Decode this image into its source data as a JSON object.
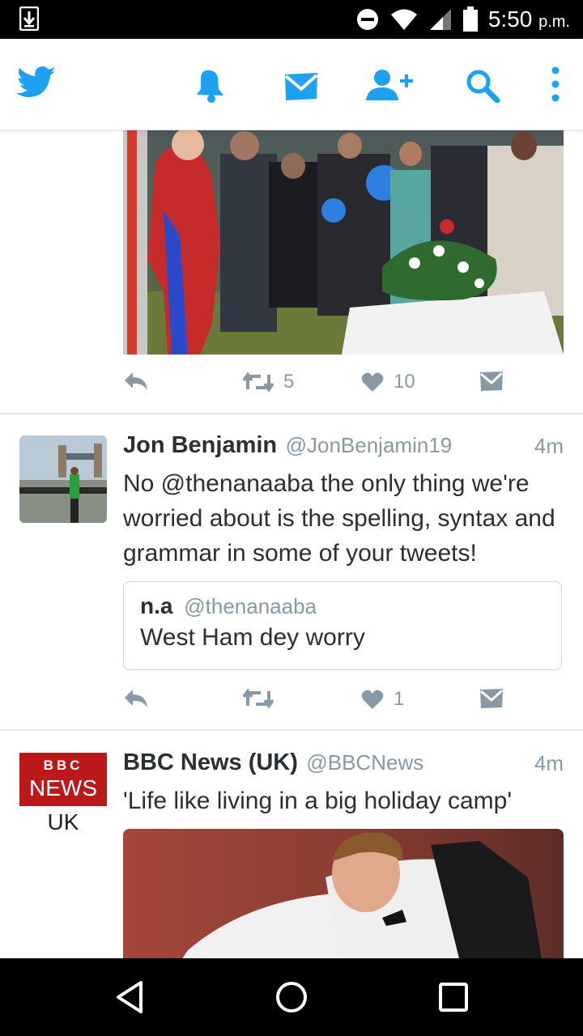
{
  "status_bar": {
    "time": "5:50",
    "ampm": "p.m."
  },
  "tweets": [
    {
      "retweets": "5",
      "likes": "10"
    },
    {
      "name": "Jon Benjamin",
      "handle": "@JonBenjamin19",
      "time": "4m",
      "text": "No @thenanaaba the only thing we're worried about is the spelling, syntax and grammar in some of your tweets!",
      "quote": {
        "name": "n.a",
        "handle": "@thenanaaba",
        "text": "West Ham dey worry"
      },
      "retweets": "",
      "likes": "1"
    },
    {
      "name": "BBC News (UK)",
      "handle": "@BBCNews",
      "time": "4m",
      "text": "'Life like living in a big holiday camp'",
      "avatar_logo": {
        "line1": "BBC",
        "line2": "NEWS",
        "line3": "UK"
      }
    }
  ],
  "colors": {
    "twitter_blue": "#1da1f2",
    "text": "#292f33",
    "muted": "#8899a6",
    "bbc_red": "#bb1919"
  }
}
